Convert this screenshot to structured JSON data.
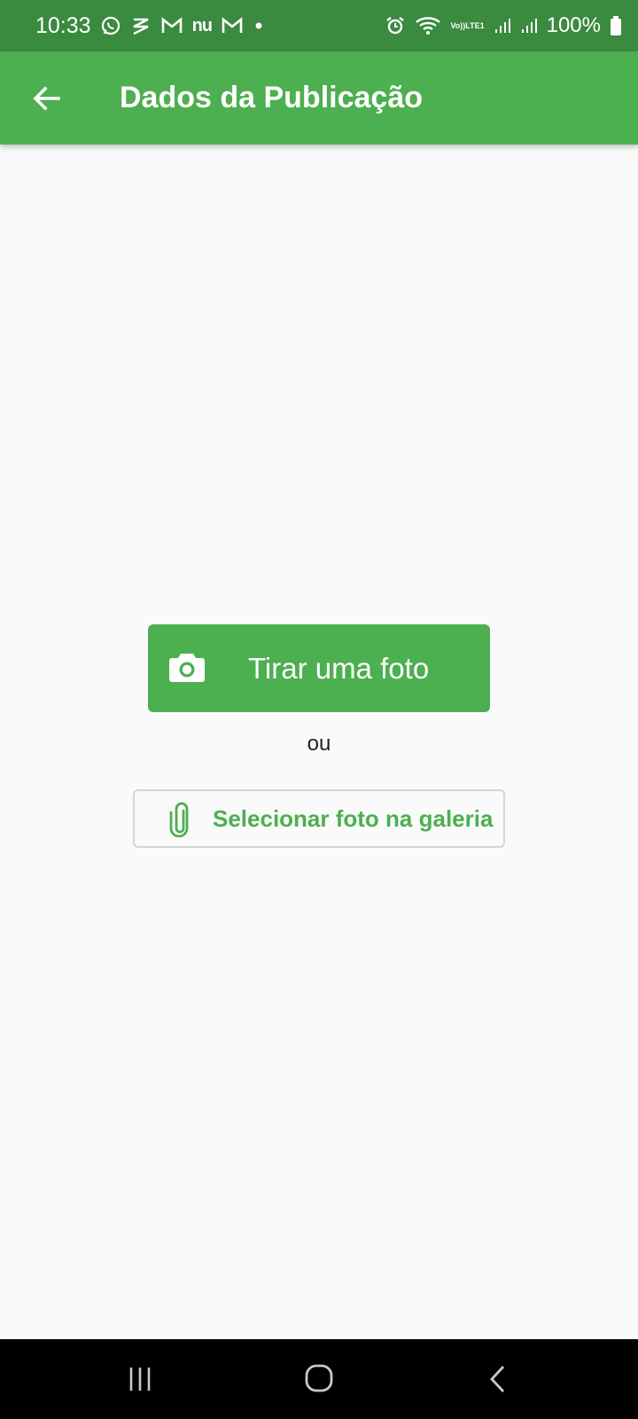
{
  "status_bar": {
    "time": "10:33",
    "battery": "100%",
    "lte_top": "Vo))",
    "lte_bottom": "LTE1",
    "nubank_text": "nu"
  },
  "app_bar": {
    "title": "Dados da Publicação",
    "back_icon": "arrow-back-icon"
  },
  "main": {
    "take_photo_label": "Tirar uma foto",
    "take_photo_icon": "camera-icon",
    "or_text": "ou",
    "gallery_label": "Selecionar foto na galeria",
    "gallery_icon": "paperclip-icon"
  },
  "colors": {
    "primary": "#4caf50",
    "status_bar": "#3a8a40",
    "background": "#fafafa"
  }
}
